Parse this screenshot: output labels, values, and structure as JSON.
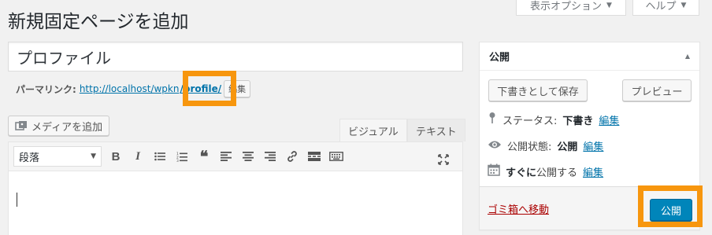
{
  "header": {
    "title": "新規固定ページを追加",
    "screen_options_label": "表示オプション",
    "help_label": "ヘルプ"
  },
  "post": {
    "title_value": "プロファイル"
  },
  "permalink": {
    "label": "パーマリンク:",
    "base_url": "http://localhost/wpkn",
    "slug": "/profile/",
    "edit_label": "編集"
  },
  "editor": {
    "add_media_label": "メディアを追加",
    "tab_visual": "ビジュアル",
    "tab_text": "テキスト",
    "format_value": "段落"
  },
  "publish_box": {
    "title": "公開",
    "save_draft_label": "下書きとして保存",
    "preview_label": "プレビュー",
    "status_label": "ステータス:",
    "status_value": "下書き",
    "status_edit": "編集",
    "visibility_label": "公開状態:",
    "visibility_value": "公開",
    "visibility_edit": "編集",
    "schedule_value": "すぐに",
    "schedule_label": "公開する",
    "schedule_edit": "編集",
    "trash_label": "ゴミ箱へ移動",
    "publish_label": "公開"
  },
  "colors": {
    "accent": "#0085ba",
    "highlight": "#f7960e",
    "trash": "#a00"
  }
}
